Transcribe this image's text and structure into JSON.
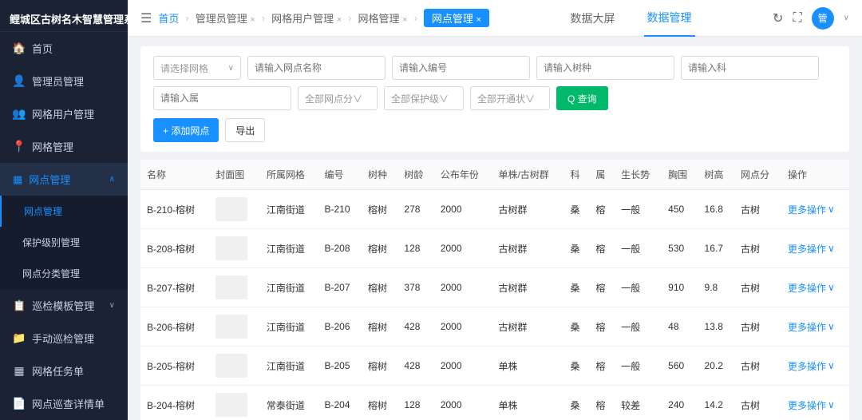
{
  "app": {
    "title": "鲤城区古树名木智慧管理系统"
  },
  "topbar": {
    "tab1": "数据大屏",
    "tab2": "数据管理"
  },
  "breadcrumb": {
    "items": [
      "首页",
      "管理员管理 ×",
      "网格用户管理 ×",
      "网格管理 ×",
      "网点管理 ×"
    ]
  },
  "sidebar": {
    "items": [
      {
        "id": "home",
        "icon": "🏠",
        "label": "首页"
      },
      {
        "id": "admin",
        "icon": "👤",
        "label": "管理员管理"
      },
      {
        "id": "grid-user",
        "icon": "👥",
        "label": "网格用户管理"
      },
      {
        "id": "grid",
        "icon": "📍",
        "label": "网格管理"
      },
      {
        "id": "node",
        "icon": "⊞",
        "label": "网点管理",
        "expanded": true
      },
      {
        "id": "patrol-template",
        "icon": "📋",
        "label": "巡检模板管理",
        "expanded": false
      },
      {
        "id": "patrol-manual",
        "icon": "📁",
        "label": "手动巡检管理"
      },
      {
        "id": "grid-task",
        "icon": "⊞",
        "label": "网格任务单"
      },
      {
        "id": "patrol-detail",
        "icon": "📄",
        "label": "网点巡查详情单"
      }
    ],
    "submenu_node": [
      {
        "id": "node-mgmt",
        "label": "网点管理",
        "active": true
      },
      {
        "id": "protection-level",
        "label": "保护级别管理"
      },
      {
        "id": "node-classify",
        "label": "网点分类管理"
      }
    ]
  },
  "filters": {
    "network_placeholder": "请选择网格",
    "name_placeholder": "请输入网点名称",
    "code_placeholder": "请输入编号",
    "tree_placeholder": "请输入树种",
    "ke_placeholder": "请输入科",
    "shu_placeholder": "请输入属",
    "score_placeholder": "全部网点分∨",
    "protection_placeholder": "全部保护级∨",
    "status_placeholder": "全部开通状∨",
    "add_label": "+ 添加网点",
    "export_label": "导出",
    "query_label": "Q 查询"
  },
  "table": {
    "columns": [
      "名称",
      "封面图",
      "所属网格",
      "编号",
      "树种",
      "树龄",
      "公布年份",
      "单株/古树群",
      "科",
      "属",
      "生长势",
      "胸围",
      "树高",
      "网点分",
      "操作"
    ],
    "rows": [
      {
        "name": "B-210-榕树",
        "cover": "",
        "network": "江南街道",
        "code": "B-210",
        "species": "榕树",
        "age": "278",
        "year": "2000",
        "type": "古树群",
        "ke": "桑",
        "shu": "榕",
        "growth": "一般",
        "chest": "450",
        "height": "16.8",
        "score": "古树",
        "action": "更多操作"
      },
      {
        "name": "B-208-榕树",
        "cover": "",
        "network": "江南街道",
        "code": "B-208",
        "species": "榕树",
        "age": "128",
        "year": "2000",
        "type": "古树群",
        "ke": "桑",
        "shu": "榕",
        "growth": "一般",
        "chest": "530",
        "height": "16.7",
        "score": "古树",
        "action": "更多操作"
      },
      {
        "name": "B-207-榕树",
        "cover": "",
        "network": "江南街道",
        "code": "B-207",
        "species": "榕树",
        "age": "378",
        "year": "2000",
        "type": "古树群",
        "ke": "桑",
        "shu": "榕",
        "growth": "一般",
        "chest": "910",
        "height": "9.8",
        "score": "古树",
        "action": "更多操作"
      },
      {
        "name": "B-206-榕树",
        "cover": "",
        "network": "江南街道",
        "code": "B-206",
        "species": "榕树",
        "age": "428",
        "year": "2000",
        "type": "古树群",
        "ke": "桑",
        "shu": "榕",
        "growth": "一般",
        "chest": "48",
        "height": "13.8",
        "score": "古树",
        "action": "更多操作"
      },
      {
        "name": "B-205-榕树",
        "cover": "",
        "network": "江南街道",
        "code": "B-205",
        "species": "榕树",
        "age": "428",
        "year": "2000",
        "type": "单株",
        "ke": "桑",
        "shu": "榕",
        "growth": "一般",
        "chest": "560",
        "height": "20.2",
        "score": "古树",
        "action": "更多操作"
      },
      {
        "name": "B-204-榕树",
        "cover": "",
        "network": "常泰街道",
        "code": "B-204",
        "species": "榕树",
        "age": "128",
        "year": "2000",
        "type": "单株",
        "ke": "桑",
        "shu": "榕",
        "growth": "较差",
        "chest": "240",
        "height": "14.2",
        "score": "古树",
        "action": "更多操作"
      }
    ]
  },
  "icons": {
    "home": "🏠",
    "admin": "👤",
    "grid_user": "👥",
    "grid": "📍",
    "node": "▦",
    "patrol_template": "📋",
    "patrol_manual": "📁",
    "grid_task": "▦",
    "patrol_detail": "📄",
    "refresh": "↻",
    "fullscreen": "⛶",
    "chevron_down": "∨",
    "chevron_right": "›",
    "separator": "›"
  },
  "colors": {
    "primary": "#1890ff",
    "sidebar_bg": "#1a2233",
    "active_menu": "#243047",
    "query_btn": "#00b96b"
  }
}
